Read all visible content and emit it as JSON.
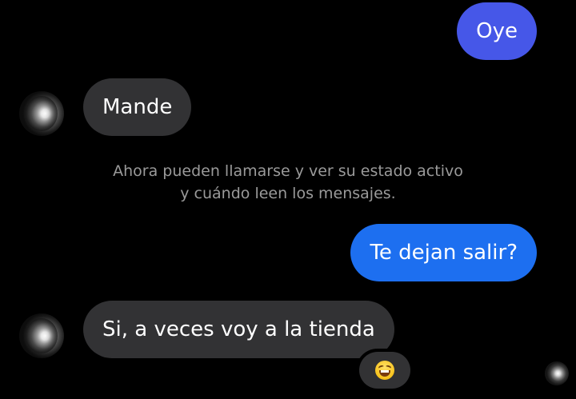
{
  "messages": {
    "outgoing_1": "Oye",
    "incoming_1": "Mande",
    "outgoing_2": "Te dejan salir?",
    "incoming_2": "Si, a veces voy a la tienda"
  },
  "notice": {
    "line_1": "Ahora pueden llamarse y ver su estado activo",
    "line_2": "y cuándo leen los mensajes."
  },
  "reaction": {
    "icon": "laughing-face-emoji"
  },
  "colors": {
    "background": "#000000",
    "outgoing_bubble_1": "#4657e8",
    "outgoing_bubble_2": "#1d6ff0",
    "incoming_bubble": "#323234",
    "notice_text": "#9a9a9a"
  }
}
